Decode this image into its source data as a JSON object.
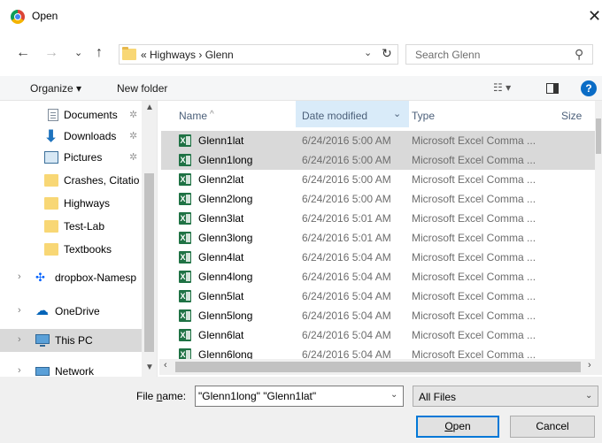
{
  "window": {
    "title": "Open",
    "close_glyph": "✕"
  },
  "nav": {
    "back_glyph": "←",
    "forward_glyph": "→",
    "recent_glyph": "⌄",
    "up_glyph": "↑",
    "address_crumbs": "«  Highways  ›  Glenn",
    "address_dropdown_glyph": "⌄",
    "refresh_glyph": "↻",
    "search_placeholder": "Search Glenn",
    "search_glyph": "⚲"
  },
  "toolbar": {
    "organize_label": "Organize ▾",
    "new_folder_label": "New folder",
    "views_glyph": "☷ ▾",
    "help_glyph": "?"
  },
  "sidebar": {
    "items": [
      {
        "label": "Documents",
        "icon": "document-icon",
        "pinned": true
      },
      {
        "label": "Downloads",
        "icon": "download-icon",
        "pinned": true
      },
      {
        "label": "Pictures",
        "icon": "pictures-icon",
        "pinned": true
      },
      {
        "label": "Crashes, Citatio",
        "icon": "folder-icon",
        "pinned": false
      },
      {
        "label": "Highways",
        "icon": "folder-icon",
        "pinned": false
      },
      {
        "label": "Test-Lab",
        "icon": "folder-icon",
        "pinned": false
      },
      {
        "label": "Textbooks",
        "icon": "folder-icon",
        "pinned": false
      },
      {
        "label": "dropbox-Namesp",
        "icon": "dropbox-icon",
        "pinned": false
      },
      {
        "label": "OneDrive",
        "icon": "onedrive-icon",
        "pinned": false
      },
      {
        "label": "This PC",
        "icon": "computer-icon",
        "pinned": false,
        "selected": true
      },
      {
        "label": "Network",
        "icon": "network-icon",
        "pinned": false
      }
    ],
    "pin_glyph": "✲",
    "expand_glyph": "›"
  },
  "columns": {
    "name": "Name",
    "date": "Date modified",
    "type": "Type",
    "size": "Size",
    "sort_glyph": "^",
    "date_dropdown_glyph": "⌄"
  },
  "files": [
    {
      "name": "Glenn1lat",
      "date": "6/24/2016 5:00 AM",
      "type": "Microsoft Excel Comma ...",
      "selected": true
    },
    {
      "name": "Glenn1long",
      "date": "6/24/2016 5:00 AM",
      "type": "Microsoft Excel Comma ...",
      "selected": true
    },
    {
      "name": "Glenn2lat",
      "date": "6/24/2016 5:00 AM",
      "type": "Microsoft Excel Comma ...",
      "selected": false
    },
    {
      "name": "Glenn2long",
      "date": "6/24/2016 5:00 AM",
      "type": "Microsoft Excel Comma ...",
      "selected": false
    },
    {
      "name": "Glenn3lat",
      "date": "6/24/2016 5:01 AM",
      "type": "Microsoft Excel Comma ...",
      "selected": false
    },
    {
      "name": "Glenn3long",
      "date": "6/24/2016 5:01 AM",
      "type": "Microsoft Excel Comma ...",
      "selected": false
    },
    {
      "name": "Glenn4lat",
      "date": "6/24/2016 5:04 AM",
      "type": "Microsoft Excel Comma ...",
      "selected": false
    },
    {
      "name": "Glenn4long",
      "date": "6/24/2016 5:04 AM",
      "type": "Microsoft Excel Comma ...",
      "selected": false
    },
    {
      "name": "Glenn5lat",
      "date": "6/24/2016 5:04 AM",
      "type": "Microsoft Excel Comma ...",
      "selected": false
    },
    {
      "name": "Glenn5long",
      "date": "6/24/2016 5:04 AM",
      "type": "Microsoft Excel Comma ...",
      "selected": false
    },
    {
      "name": "Glenn6lat",
      "date": "6/24/2016 5:04 AM",
      "type": "Microsoft Excel Comma ...",
      "selected": false
    },
    {
      "name": "Glenn6long",
      "date": "6/24/2016 5:04 AM",
      "type": "Microsoft Excel Comma ...",
      "selected": false
    }
  ],
  "scroll": {
    "up": "▲",
    "down": "▼",
    "left": "‹",
    "right": "›"
  },
  "footer": {
    "filename_label_prefix": "File ",
    "filename_label_underlined": "n",
    "filename_label_suffix": "ame:",
    "filename_value": "\"Glenn1long\" \"Glenn1lat\"",
    "filename_dropdown_glyph": "⌄",
    "filter_value": "All Files",
    "filter_dropdown_glyph": "⌄",
    "open_label_underlined": "O",
    "open_label_rest": "pen",
    "cancel_label": "Cancel"
  },
  "colors": {
    "accent": "#0078d7",
    "selection": "#d9d9d9",
    "sorted_column": "#d9ebf9",
    "excel_green": "#1f7244"
  }
}
